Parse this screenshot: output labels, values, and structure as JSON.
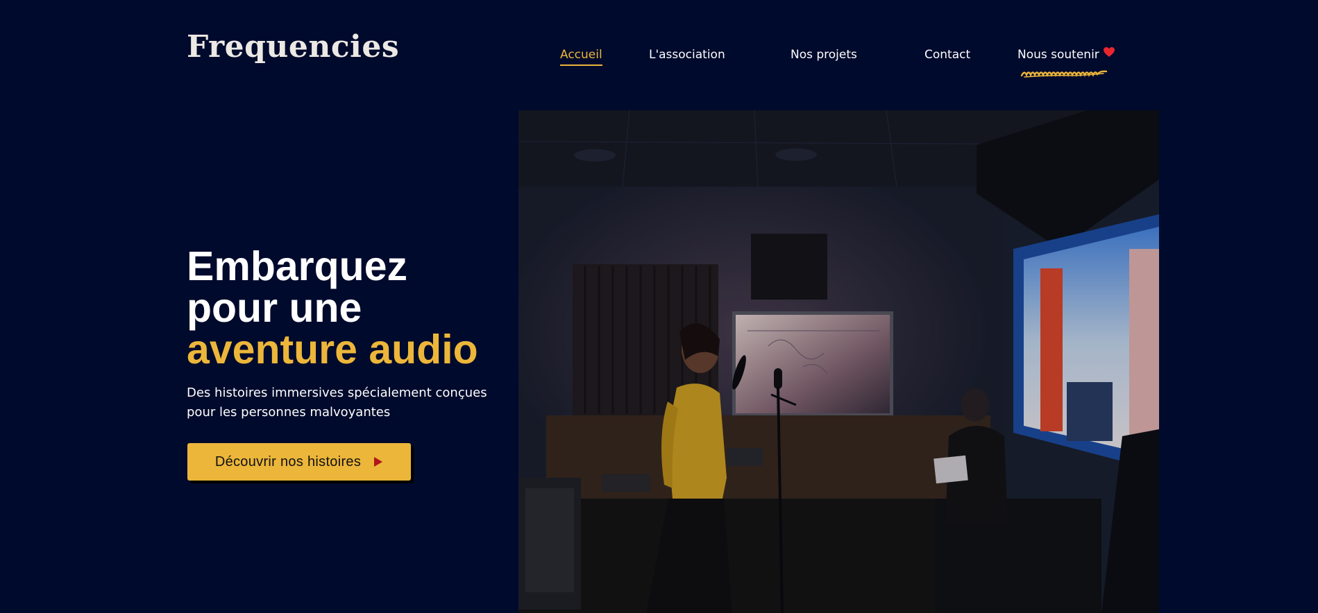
{
  "header": {
    "logo": "Frequencies",
    "nav": {
      "home": "Accueil",
      "association": "L'association",
      "projects": "Nos projets",
      "contact": "Contact",
      "support": "Nous soutenir"
    }
  },
  "hero": {
    "title_line1": "Embarquez",
    "title_line2": "pour une",
    "title_line3": "aventure audio",
    "subtitle_line1": "Des histoires immersives spécialement conçues",
    "subtitle_line2": "pour les personnes malvoyantes",
    "cta_label": "Découvrir nos histoires"
  },
  "colors": {
    "background": "#000a2c",
    "accent": "#ecb63a",
    "heart": "#e8262e",
    "cta_arrow": "#b0161c"
  },
  "icons": [
    "heart-icon",
    "scribble-underline",
    "play-arrow-icon"
  ]
}
